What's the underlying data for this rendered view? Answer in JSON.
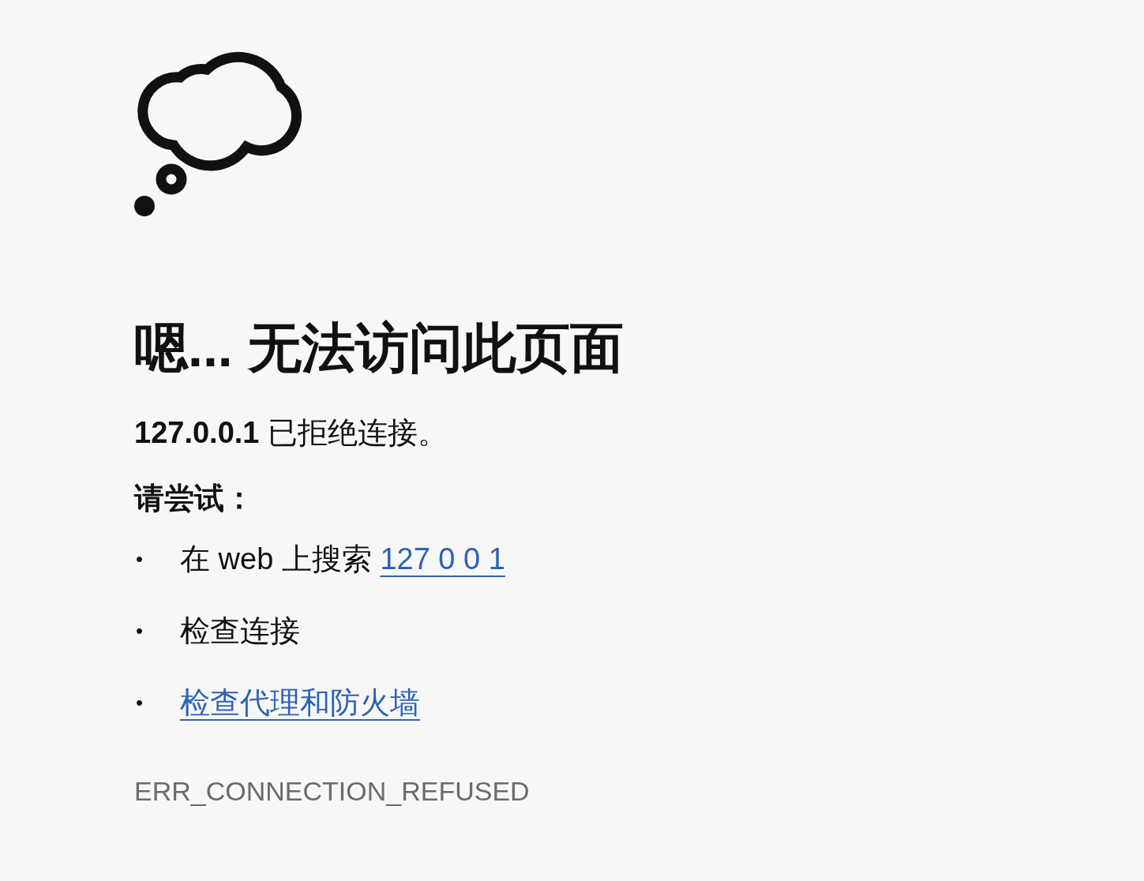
{
  "heading": "嗯... 无法访问此页面",
  "message": "**127.0.0.1** 已拒绝连接。",
  "suggestions_label": "请尝试：",
  "suggestions": [
    {
      "kind": "text_link",
      "bullet": "•",
      "text": "在 web 上搜索 ",
      "link": "127 0 0 1"
    },
    {
      "kind": "text",
      "bullet": "•",
      "text": "检查连接"
    },
    {
      "kind": "link",
      "bullet": "•",
      "link": "检查代理和防火墙"
    }
  ],
  "error_code": "ERR_CONNECTION_REFUSED"
}
